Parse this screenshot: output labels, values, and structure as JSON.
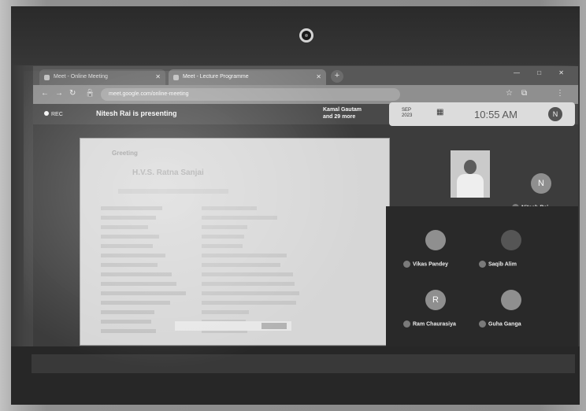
{
  "browser": {
    "tabs": [
      {
        "label": "Meet - Online Meeting"
      },
      {
        "label": "Meet - Lecture Programme"
      }
    ],
    "new_tab": "+",
    "window_controls": [
      "—",
      "□",
      "✕"
    ],
    "url": "meet.google.com/online-meeting"
  },
  "meeting": {
    "rec_label": "REC",
    "presenter": "Nitesh Rai is presenting",
    "viewers_line1": "Kamal Gautam",
    "viewers_line2": "and 29 more"
  },
  "popup": {
    "line1": "SEP",
    "line2": "2023",
    "clock": "10:55 AM",
    "avatar_letter": "N"
  },
  "shared_doc": {
    "heading": "Greeting",
    "name": "H.V.S. Ratna Sanjai"
  },
  "participants": [
    {
      "name": "Nitesh Rai",
      "initial": "N"
    },
    {
      "name": "Vikas Pandey",
      "initial": ""
    },
    {
      "name": "Saqib Alim",
      "initial": ""
    },
    {
      "name": "Ram Chaurasiya",
      "initial": "R"
    },
    {
      "name": "Guha Ganga",
      "initial": ""
    }
  ],
  "colors": {
    "screen": "#3f3f3f",
    "panel": "#2d2d2d"
  }
}
